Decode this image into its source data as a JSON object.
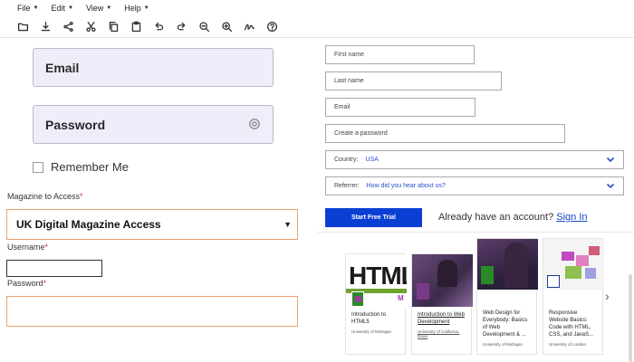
{
  "menu": {
    "file": "File",
    "edit": "Edit",
    "view": "View",
    "help": "Help"
  },
  "toolbar_icons": [
    "folder-icon",
    "download-icon",
    "share-icon",
    "cut-icon",
    "copy-icon",
    "paste-icon",
    "undo-icon",
    "redo-icon",
    "zoom-out-icon",
    "zoom-in-icon",
    "signature-icon",
    "help-icon"
  ],
  "left": {
    "email_label": "Email",
    "password_label": "Password",
    "remember_label": "Remember Me",
    "magazine_label": "Magazine to Access",
    "magazine_value": "UK Digital Magazine Access",
    "username_label": "Username",
    "password_small_label": "Password",
    "required_mark": "*"
  },
  "right": {
    "first_name": "First name",
    "last_name": "Last name",
    "email": "Email",
    "create_password": "Create a password",
    "country_label": "Country:",
    "country_value": "USA",
    "referrer_label": "Referrer:",
    "referrer_value": "How did you hear about us?",
    "trial_button": "Start Free Trial",
    "have_account": "Already have an account?",
    "sign_in": "Sign In"
  },
  "courses": [
    {
      "title": "Introduction to HTML5",
      "university": "University of Michigan",
      "thumb_text": "HTML"
    },
    {
      "title": "Introduction to Web Development",
      "university": "University of California, Davis",
      "thumb_text": ""
    },
    {
      "title": "Web Design for Everybody: Basics of Web Development & ...",
      "university": "University of Michigan",
      "thumb_text": ""
    },
    {
      "title": "Responsive Website Basics: Code with HTML, CSS, and JavaS...",
      "university": "University of London",
      "thumb_text": ""
    }
  ],
  "colors": {
    "accent_blue": "#0b3fd4",
    "link_blue": "#1446c8",
    "focus_orange": "#f0a070",
    "input_fill": "#eeedfa",
    "required_red": "#d32f2f"
  }
}
